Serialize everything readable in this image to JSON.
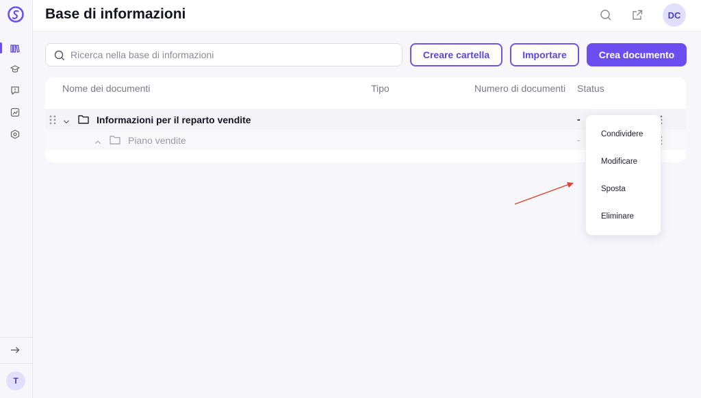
{
  "header": {
    "title": "Base di informazioni",
    "user_initials": "DC"
  },
  "sidebar": {
    "user_initial": "T",
    "items": [
      {
        "icon": "library-icon",
        "active": true
      },
      {
        "icon": "graduation-cap-icon",
        "active": false
      },
      {
        "icon": "feedback-icon",
        "active": false
      },
      {
        "icon": "analytics-icon",
        "active": false
      },
      {
        "icon": "settings-hex-icon",
        "active": false
      }
    ],
    "expand_icon": "arrow-right-icon"
  },
  "toolbar": {
    "search_placeholder": "Ricerca nella base di informazioni",
    "create_folder_label": "Creare cartella",
    "import_label": "Importare",
    "create_document_label": "Crea documento"
  },
  "table": {
    "columns": [
      "Nome dei documenti",
      "Tipo",
      "Numero di documenti",
      "Status"
    ],
    "rows": [
      {
        "name": "Informazioni per il reparto vendite",
        "status": "-",
        "expanded": true,
        "level": 0
      },
      {
        "name": "Piano vendite",
        "status": "-",
        "expanded": false,
        "level": 1
      }
    ]
  },
  "context_menu": {
    "items": [
      "Condividere",
      "Modificare",
      "Sposta",
      "Eliminare"
    ]
  },
  "colors": {
    "accent": "#6b4ef0",
    "annotation_arrow": "#e0442c"
  }
}
